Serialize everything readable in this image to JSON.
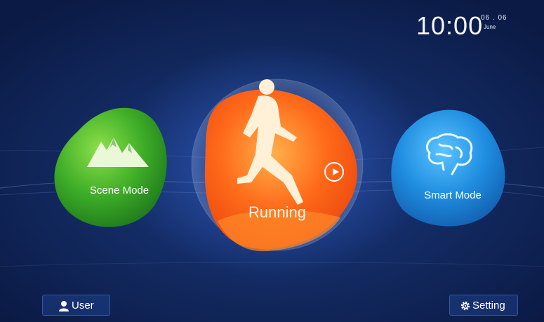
{
  "clock": {
    "time": "10:00",
    "date": "06 . 06",
    "month": "June"
  },
  "tiles": {
    "scene": {
      "label": "Scene Mode",
      "icon": "mountains-icon",
      "color": "#44b52a"
    },
    "running": {
      "label": "Running",
      "icon": "runner-icon",
      "color": "#ff6a1a"
    },
    "smart": {
      "label": "Smart Mode",
      "icon": "brain-icon",
      "color": "#1f8de0"
    }
  },
  "bottom": {
    "user_label": "User",
    "setting_label": "Setting"
  }
}
